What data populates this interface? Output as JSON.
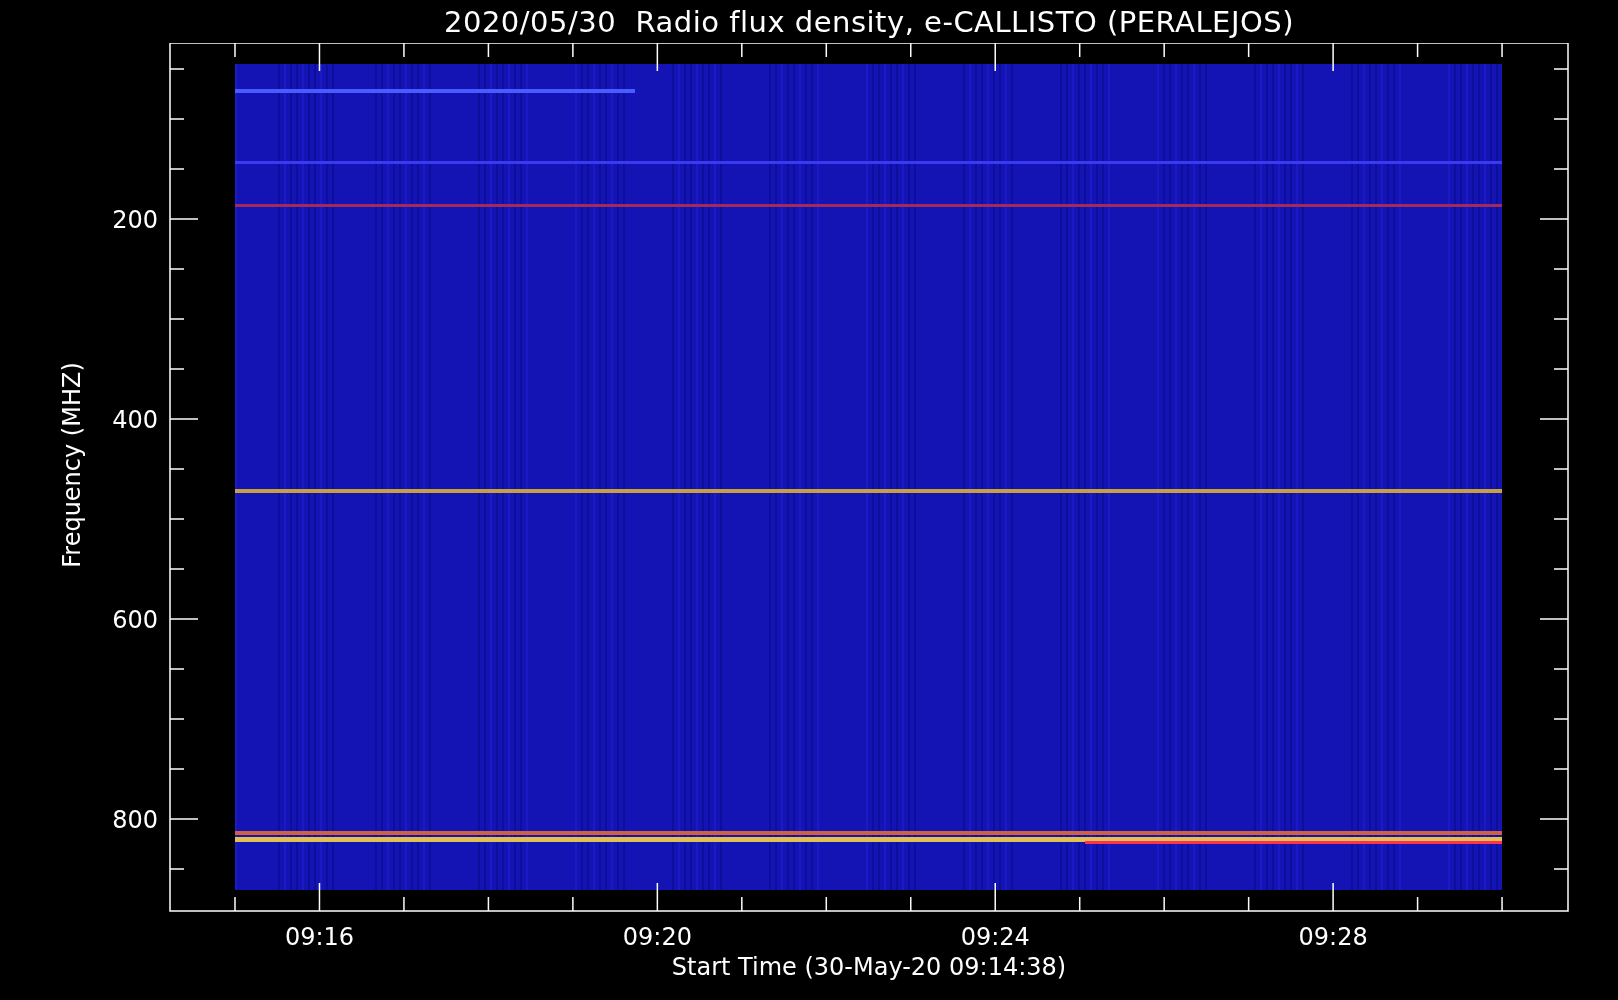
{
  "title": "2020/05/30  Radio flux density, e-CALLISTO (PERALEJOS)",
  "plot": {
    "kind": "spectrogram",
    "ylabel": "Frequency (MHZ)",
    "xlabel": "Start Time (30-May-20 09:14:38)",
    "yticks": [
      "200",
      "400",
      "600",
      "800"
    ],
    "xticks": [
      "09:16",
      "09:20",
      "09:24",
      "09:28"
    ]
  }
}
